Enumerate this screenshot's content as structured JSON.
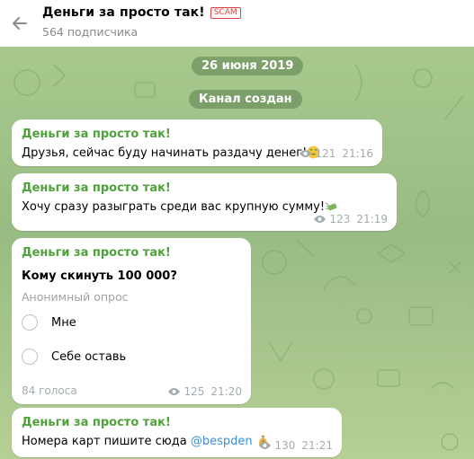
{
  "header": {
    "title": "Деньги за просто так!",
    "scam_badge": "SCAM",
    "subscribers": "564 подписчика"
  },
  "service": {
    "date": "26 июня 2019",
    "channel_created": "Канал создан"
  },
  "messages": [
    {
      "from": "Деньги за просто так!",
      "text": "Друзья, сейчас буду начинать раздачу денег!",
      "emoji": "money-mouth-face",
      "views": "121",
      "time": "21:16"
    },
    {
      "from": "Деньги за просто так!",
      "text": "Хочу сразу разыграть среди вас крупную сумму!",
      "emoji": "money-with-wings",
      "views": "123",
      "time": "21:19"
    },
    {
      "from": "Деньги за просто так!",
      "poll": {
        "question": "Кому скинуть 100 000?",
        "type": "Анонимный опрос",
        "options": [
          "Мне",
          "Себе оставь"
        ],
        "votes": "84 голоса"
      },
      "views": "125",
      "time": "21:20"
    },
    {
      "from": "Деньги за просто так!",
      "text": "Номера карт пишите сюда ",
      "link": "@bespden",
      "emoji": "money-bag",
      "views": "130",
      "time": "21:21"
    }
  ],
  "colors": {
    "sender": "#4fa13a",
    "link": "#3a8ed3",
    "scam": "#e0413d",
    "chat_bg": "#a3c48e"
  }
}
